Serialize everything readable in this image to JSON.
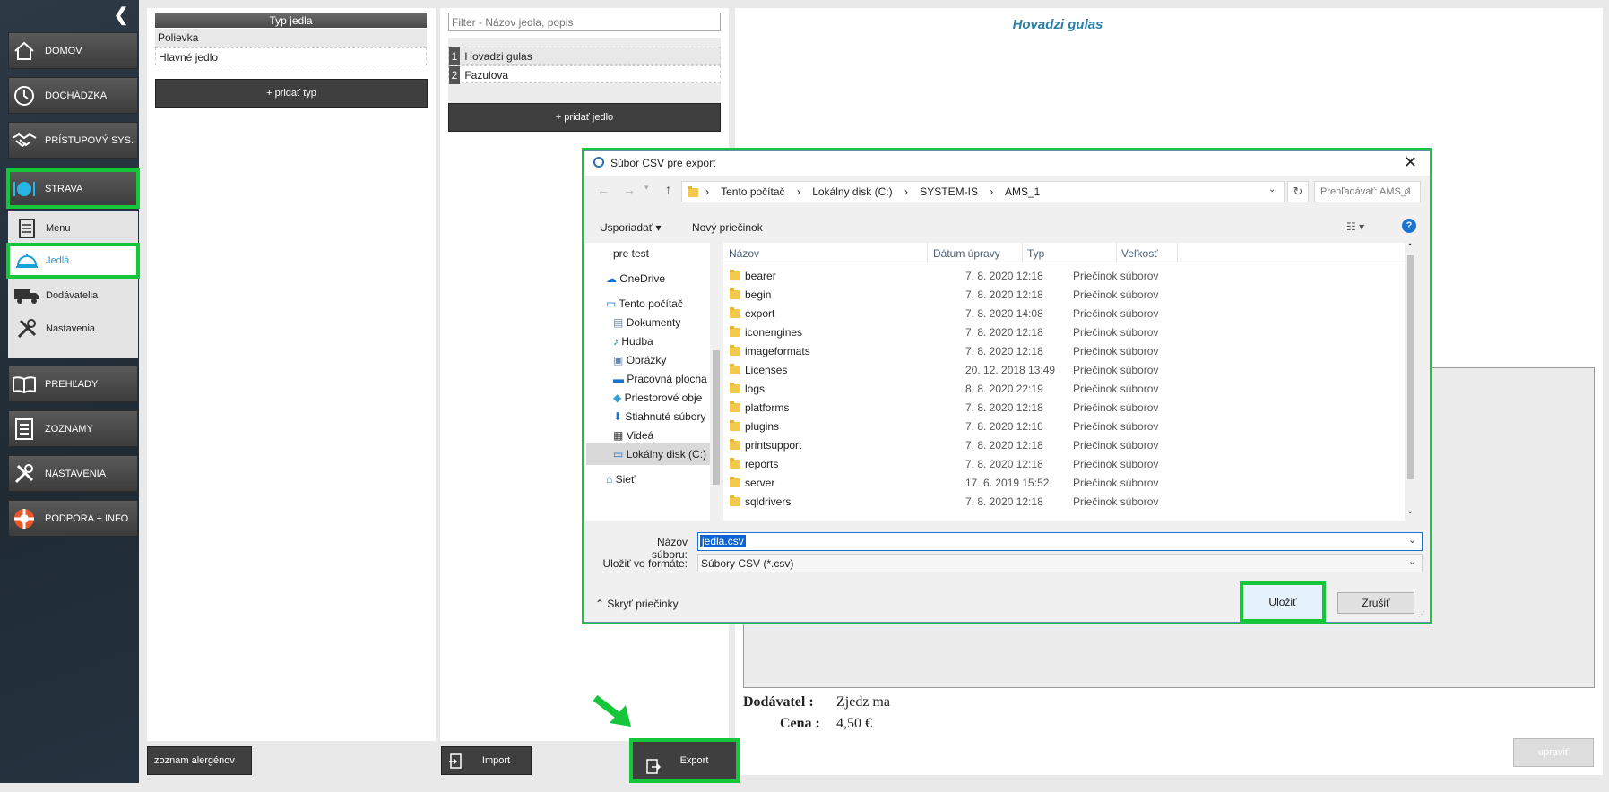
{
  "sidebar": {
    "nav": [
      {
        "label": "DOMOV",
        "icon": "home-icon"
      },
      {
        "label": "DOCHÁDZKA",
        "icon": "clock-icon"
      },
      {
        "label": "PRÍSTUPOVÝ SYS.",
        "icon": "handshake-icon"
      },
      {
        "label": "STRAVA",
        "icon": "plate-icon"
      }
    ],
    "sub": [
      {
        "label": "Menu",
        "icon": "menu-icon"
      },
      {
        "label": "Jedlá",
        "icon": "cloche-icon"
      },
      {
        "label": "Dodávatelia",
        "icon": "truck-icon"
      },
      {
        "label": "Nastavenia",
        "icon": "tools-icon"
      }
    ],
    "nav2": [
      {
        "label": "PREHĽADY",
        "icon": "book-icon"
      },
      {
        "label": "ZOZNAMY",
        "icon": "list-icon"
      },
      {
        "label": "NASTAVENIA",
        "icon": "tools-icon"
      },
      {
        "label": "PODPORA + INFO",
        "icon": "lifebuoy-icon"
      }
    ]
  },
  "types": {
    "header": "Typ jedla",
    "items": [
      "Polievka",
      "Hlavné jedlo"
    ],
    "add_label": "+ pridať typ",
    "allergen_label": "zoznam alergénov"
  },
  "meals": {
    "filter_placeholder": "Filter - Názov jedla, popis",
    "items": [
      {
        "num": "1",
        "name": "Hovadzi gulas"
      },
      {
        "num": "2",
        "name": "Fazulova"
      }
    ],
    "add_label": "+ pridať jedlo",
    "import_label": "Import",
    "export_label": "Export"
  },
  "detail": {
    "title": "Hovadzi gulas",
    "supplier_label": "Dodávatel :",
    "supplier_value": "Zjedz ma",
    "price_label": "Cena :",
    "price_value": "4,50 €",
    "edit_label": "upraviť"
  },
  "dialog": {
    "title": "Súbor CSV pre export",
    "breadcrumb": [
      "Tento počítač",
      "Lokálny disk (C:)",
      "SYSTEM-IS",
      "AMS_1"
    ],
    "search_placeholder": "Prehľadávať: AMS_1",
    "organize_label": "Usporiadať",
    "new_folder_label": "Nový priečinok",
    "columns": {
      "name": "Názov",
      "date": "Dátum úpravy",
      "type": "Typ",
      "size": "Veľkosť"
    },
    "nav": [
      "pre test",
      "OneDrive",
      "Tento počítač",
      "Dokumenty",
      "Hudba",
      "Obrázky",
      "Pracovná plocha",
      "Priestorové obje",
      "Stiahnuté súbory",
      "Videá",
      "Lokálny disk (C:)",
      "Sieť"
    ],
    "files": [
      {
        "name": "bearer",
        "date": "7. 8. 2020 12:18",
        "type": "Priečinok súborov"
      },
      {
        "name": "begin",
        "date": "7. 8. 2020 12:18",
        "type": "Priečinok súborov"
      },
      {
        "name": "export",
        "date": "7. 8. 2020 14:08",
        "type": "Priečinok súborov"
      },
      {
        "name": "iconengines",
        "date": "7. 8. 2020 12:18",
        "type": "Priečinok súborov"
      },
      {
        "name": "imageformats",
        "date": "7. 8. 2020 12:18",
        "type": "Priečinok súborov"
      },
      {
        "name": "Licenses",
        "date": "20. 12. 2018 13:49",
        "type": "Priečinok súborov"
      },
      {
        "name": "logs",
        "date": "8. 8. 2020 22:19",
        "type": "Priečinok súborov"
      },
      {
        "name": "platforms",
        "date": "7. 8. 2020 12:18",
        "type": "Priečinok súborov"
      },
      {
        "name": "plugins",
        "date": "7. 8. 2020 12:18",
        "type": "Priečinok súborov"
      },
      {
        "name": "printsupport",
        "date": "7. 8. 2020 12:18",
        "type": "Priečinok súborov"
      },
      {
        "name": "reports",
        "date": "7. 8. 2020 12:18",
        "type": "Priečinok súborov"
      },
      {
        "name": "server",
        "date": "17. 6. 2019 15:52",
        "type": "Priečinok súborov"
      },
      {
        "name": "sqldrivers",
        "date": "7. 8. 2020 12:18",
        "type": "Priečinok súborov"
      }
    ],
    "filename_label": "Názov súboru:",
    "filename_value": "jedla.csv",
    "format_label": "Uložiť vo formáte:",
    "format_value": "Súbory CSV (*.csv)",
    "hide_folders_label": "Skryť priečinky",
    "save_label": "Uložiť",
    "cancel_label": "Zrušiť"
  },
  "colors": {
    "highlight": "#15c63a",
    "accent_title": "#2a7fa8"
  }
}
